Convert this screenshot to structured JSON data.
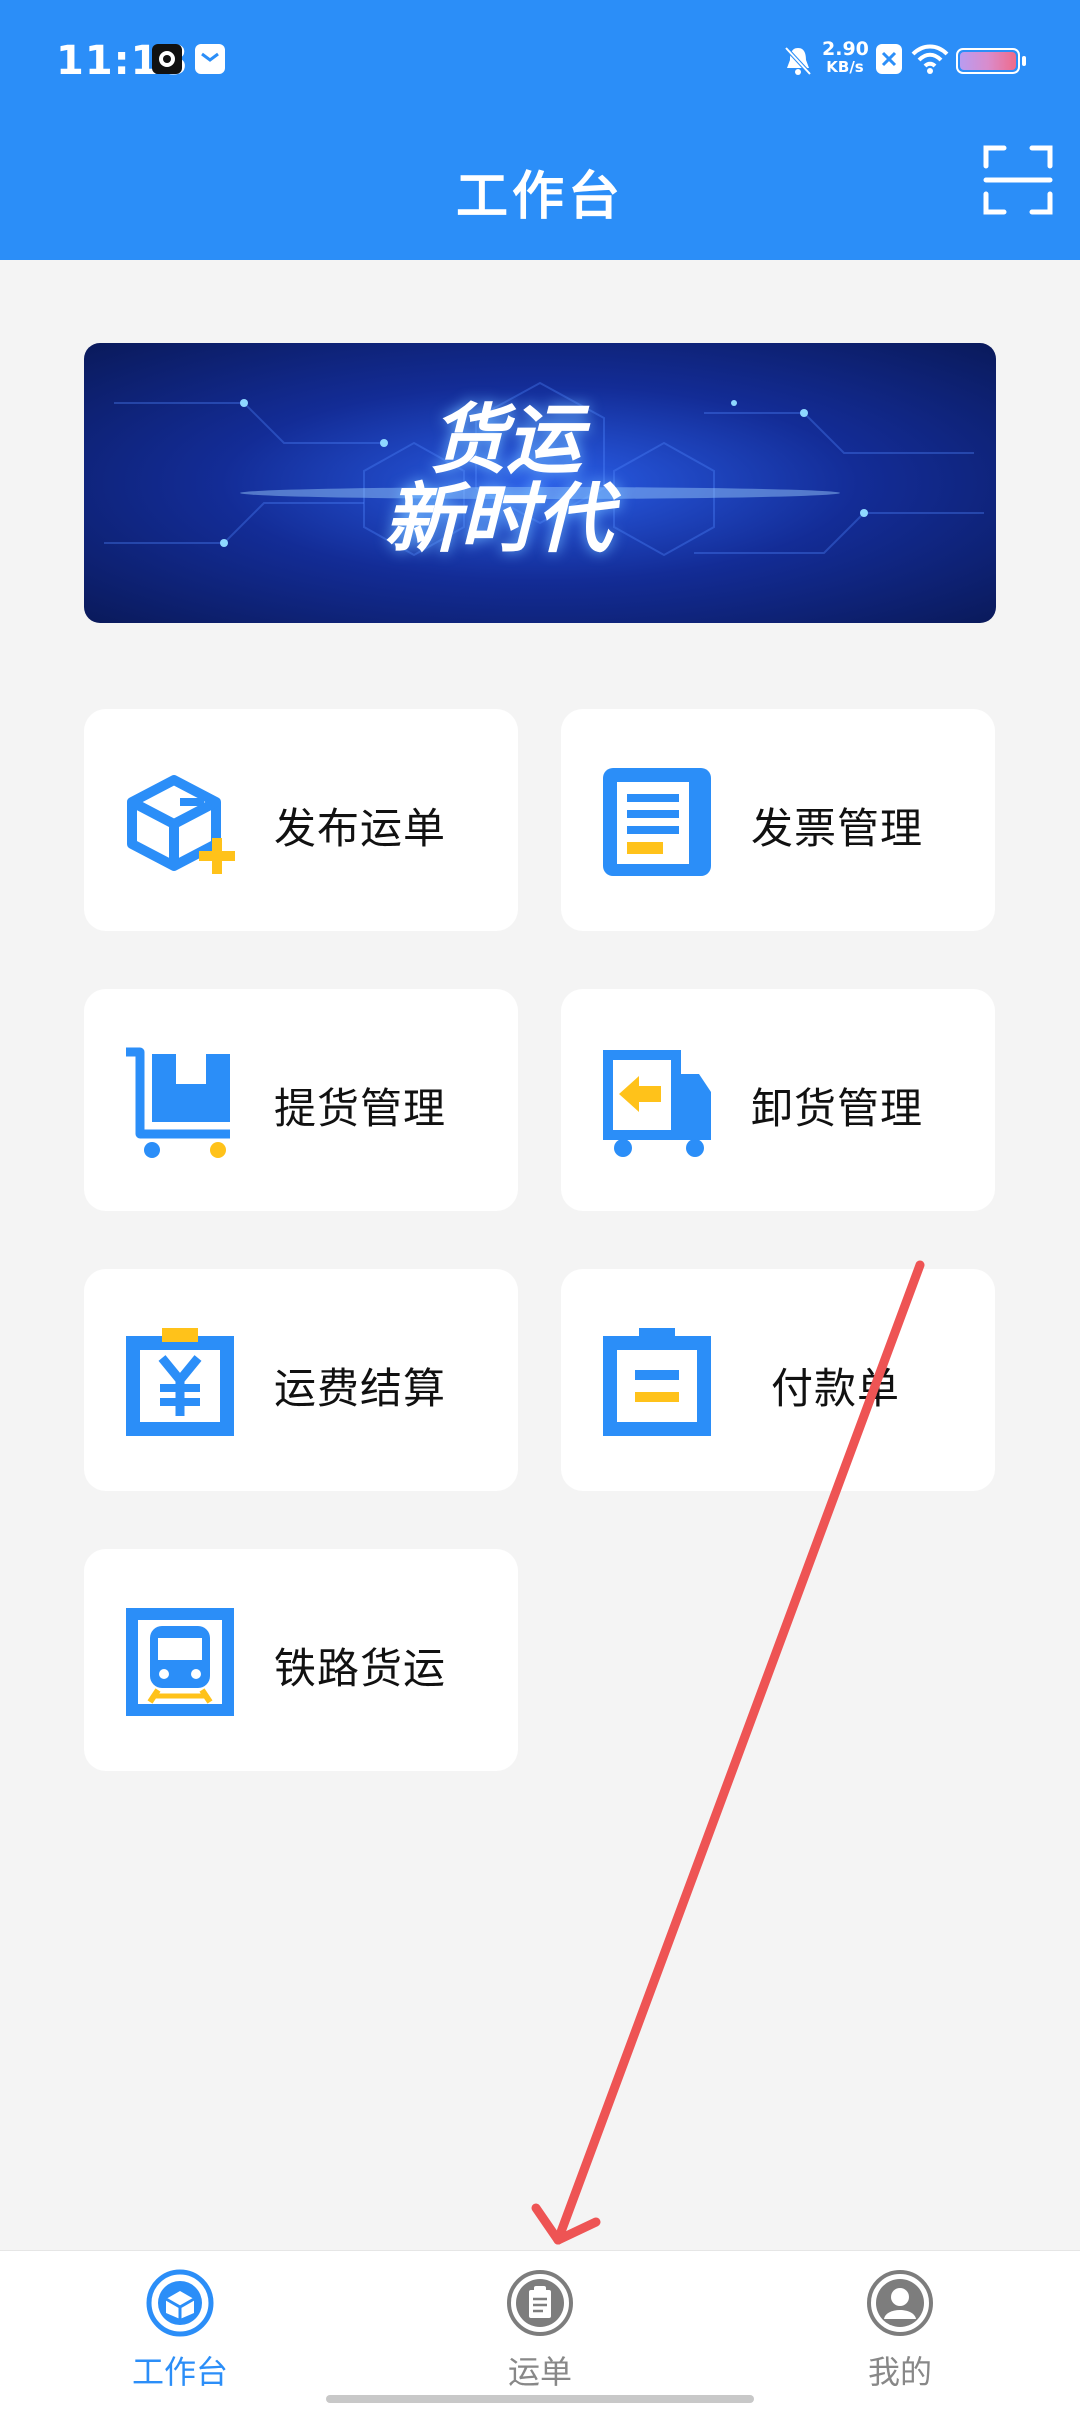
{
  "status_bar": {
    "time": "11:18",
    "net_speed_value": "2.90",
    "net_speed_unit": "KB/s"
  },
  "header": {
    "title": "工作台"
  },
  "banner": {
    "line1": "货运",
    "line2": "新时代"
  },
  "menu": [
    {
      "label": "发布运单",
      "icon": "publish-waybill-icon"
    },
    {
      "label": "发票管理",
      "icon": "invoice-icon"
    },
    {
      "label": "提货管理",
      "icon": "pickup-cart-icon"
    },
    {
      "label": "卸货管理",
      "icon": "unload-truck-icon"
    },
    {
      "label": "运费结算",
      "icon": "freight-settlement-icon"
    },
    {
      "label": "付款单",
      "icon": "payment-order-icon"
    },
    {
      "label": "铁路货运",
      "icon": "railway-train-icon"
    }
  ],
  "bottom_nav": [
    {
      "label": "工作台",
      "active": true
    },
    {
      "label": "运单",
      "active": false
    },
    {
      "label": "我的",
      "active": false
    }
  ],
  "colors": {
    "primary": "#2b8ef8",
    "accent": "#ffc21a",
    "background": "#f4f4f4",
    "annotation_arrow": "#ee5454"
  }
}
